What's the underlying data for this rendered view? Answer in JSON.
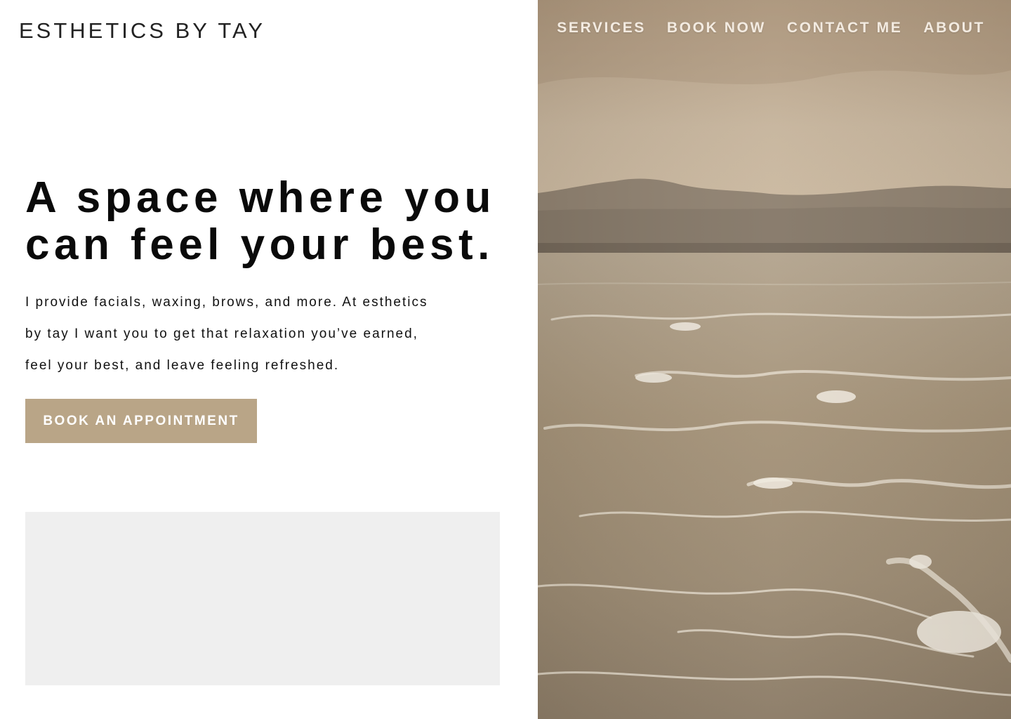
{
  "header": {
    "brand": "ESTHETICS BY TAY",
    "nav": [
      {
        "label": "SERVICES"
      },
      {
        "label": "BOOK NOW"
      },
      {
        "label": "CONTACT ME"
      },
      {
        "label": "ABOUT"
      }
    ]
  },
  "hero": {
    "title_lines": [
      "A space where you",
      "can feel your best."
    ],
    "description_lines": [
      "I provide facials, waxing, brows, and more. At esthetics",
      "by tay I want you to get that relaxation you’ve earned,",
      "feel your best, and leave feeling refreshed."
    ],
    "cta_label": "BOOK AN APPOINTMENT"
  },
  "colors": {
    "accent": "#b9a587",
    "nav_text": "#f3ebe1",
    "placeholder": "#efefef"
  }
}
